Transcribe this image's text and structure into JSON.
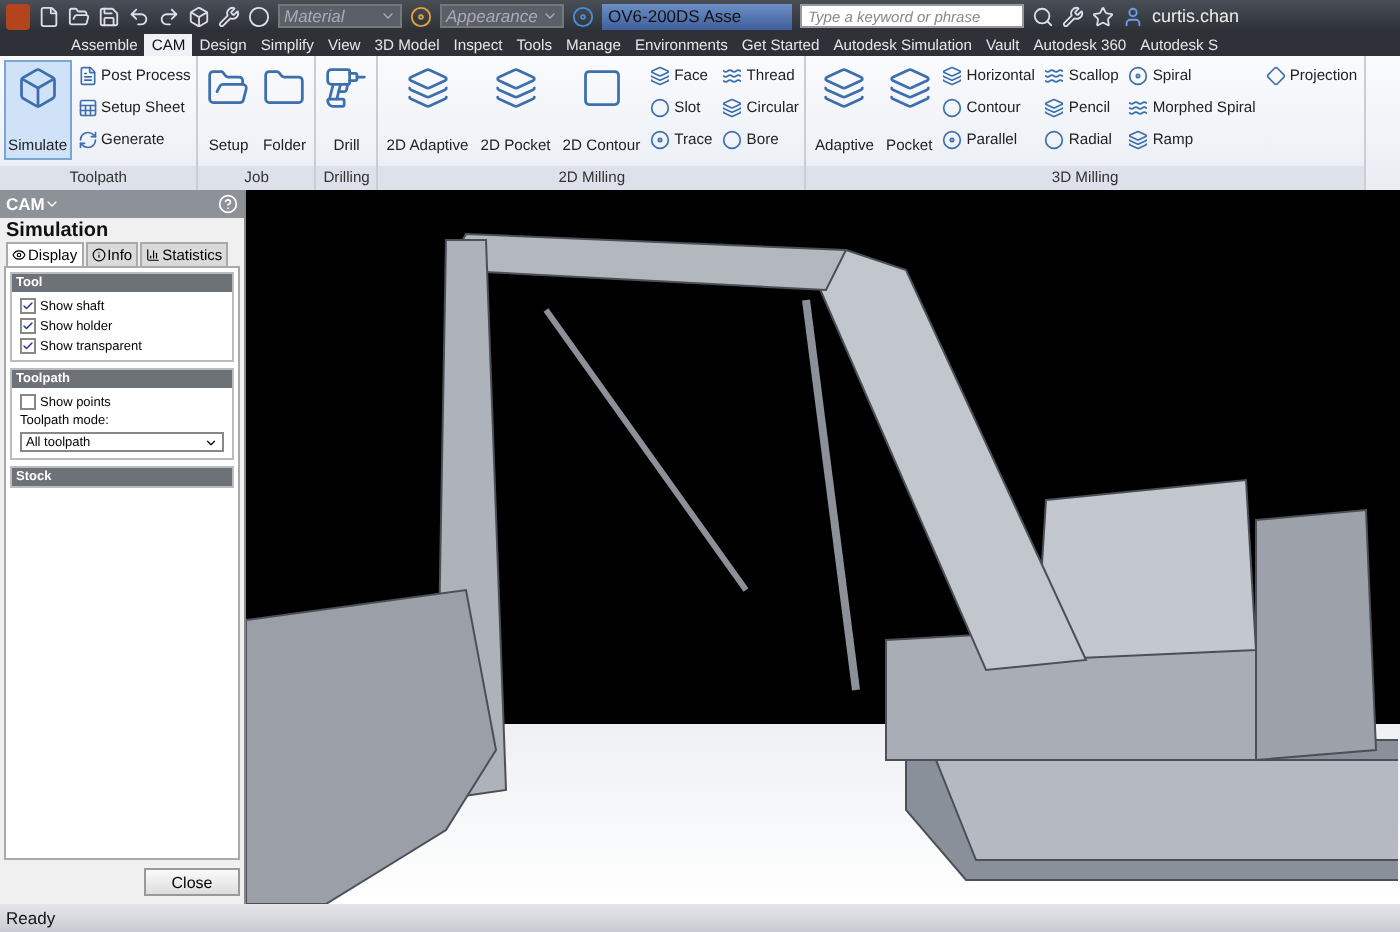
{
  "title_bar": {
    "material": "Material",
    "appearance": "Appearance",
    "document": "OV6-200DS Asse",
    "search": {
      "placeholder": "Type a keyword or phrase"
    },
    "user": "curtis.chan"
  },
  "tabs": [
    {
      "label": "Assemble",
      "selected": false
    },
    {
      "label": "CAM",
      "selected": true
    },
    {
      "label": "Design",
      "selected": false
    },
    {
      "label": "Simplify",
      "selected": false
    },
    {
      "label": "View",
      "selected": false
    },
    {
      "label": "3D Model",
      "selected": false
    },
    {
      "label": "Inspect",
      "selected": false
    },
    {
      "label": "Tools",
      "selected": false
    },
    {
      "label": "Manage",
      "selected": false
    },
    {
      "label": "Environments",
      "selected": false
    },
    {
      "label": "Get Started",
      "selected": false
    },
    {
      "label": "Autodesk Simulation",
      "selected": false
    },
    {
      "label": "Vault",
      "selected": false
    },
    {
      "label": "Autodesk 360",
      "selected": false
    },
    {
      "label": "Autodesk S",
      "selected": false
    }
  ],
  "ribbon": {
    "groups": [
      {
        "label": "Toolpath",
        "items": [
          {
            "label": "Simulate",
            "kind": "large",
            "selected": true
          },
          {
            "label": "Post Process",
            "kind": "small",
            "selected": false
          },
          {
            "label": "Setup Sheet",
            "kind": "small",
            "selected": false
          },
          {
            "label": "Generate",
            "kind": "small",
            "selected": false
          }
        ]
      },
      {
        "label": "Job",
        "items": [
          {
            "label": "Setup",
            "kind": "large",
            "selected": false
          },
          {
            "label": "Folder",
            "kind": "large",
            "selected": false
          }
        ]
      },
      {
        "label": "Drilling",
        "items": [
          {
            "label": "Drill",
            "kind": "large",
            "selected": false
          }
        ]
      },
      {
        "label": "2D Milling",
        "items": [
          {
            "label": "2D Adaptive",
            "kind": "large",
            "selected": false
          },
          {
            "label": "2D Pocket",
            "kind": "large",
            "selected": false
          },
          {
            "label": "2D Contour",
            "kind": "large",
            "selected": false
          },
          {
            "label": "Face",
            "kind": "small",
            "selected": false
          },
          {
            "label": "Slot",
            "kind": "small",
            "selected": false
          },
          {
            "label": "Trace",
            "kind": "small",
            "selected": false
          },
          {
            "label": "Thread",
            "kind": "small",
            "selected": false
          },
          {
            "label": "Circular",
            "kind": "small",
            "selected": false
          },
          {
            "label": "Bore",
            "kind": "small",
            "selected": false
          }
        ]
      },
      {
        "label": "3D Milling",
        "items": [
          {
            "label": "Adaptive",
            "kind": "large",
            "selected": false
          },
          {
            "label": "Pocket",
            "kind": "large",
            "selected": false
          },
          {
            "label": "Horizontal",
            "kind": "small",
            "selected": false
          },
          {
            "label": "Contour",
            "kind": "small",
            "selected": false
          },
          {
            "label": "Parallel",
            "kind": "small",
            "selected": false
          },
          {
            "label": "Scallop",
            "kind": "small",
            "selected": false
          },
          {
            "label": "Pencil",
            "kind": "small",
            "selected": false
          },
          {
            "label": "Radial",
            "kind": "small",
            "selected": false
          },
          {
            "label": "Spiral",
            "kind": "small",
            "selected": false
          },
          {
            "label": "Morphed Spiral",
            "kind": "small",
            "selected": false
          },
          {
            "label": "Ramp",
            "kind": "small",
            "selected": false
          },
          {
            "label": "Projection",
            "kind": "small",
            "selected": false
          }
        ]
      }
    ]
  },
  "panel": {
    "header": "CAM",
    "title": "Simulation",
    "tabs": [
      {
        "label": "Display",
        "selected": true
      },
      {
        "label": "Info",
        "selected": false
      },
      {
        "label": "Statistics",
        "selected": false
      }
    ],
    "sections": [
      {
        "title": "Tool",
        "items": [
          {
            "kind": "checkbox",
            "label": "Show shaft",
            "checked": true
          },
          {
            "kind": "checkbox",
            "label": "Show holder",
            "checked": true
          },
          {
            "kind": "checkbox",
            "label": "Show transparent",
            "checked": true
          }
        ]
      },
      {
        "title": "Toolpath",
        "items": [
          {
            "kind": "checkbox",
            "label": "Show points",
            "checked": false
          },
          {
            "kind": "select",
            "label": "Toolpath mode:",
            "value": "All toolpath"
          }
        ]
      },
      {
        "title": "Stock"
      }
    ],
    "close_button": "Close"
  },
  "status_bar": "Ready"
}
